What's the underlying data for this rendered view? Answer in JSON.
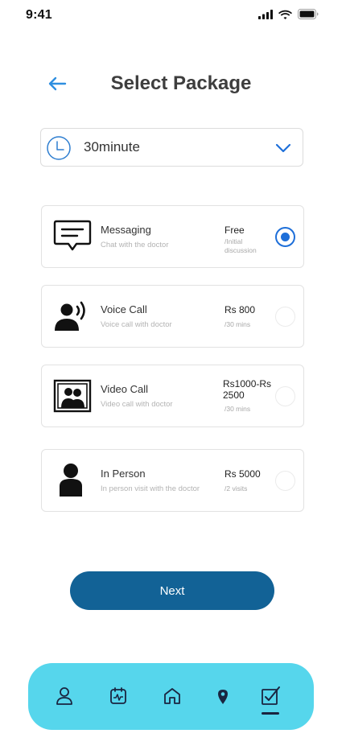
{
  "status": {
    "time": "9:41"
  },
  "header": {
    "title": "Select Package"
  },
  "duration": {
    "value": "30minute"
  },
  "packages": [
    {
      "name": "Messaging",
      "desc": "Chat with the doctor",
      "price": "Free",
      "note": "/Initial discussion",
      "selected": true,
      "icon": "message-icon"
    },
    {
      "name": "Voice Call",
      "desc": "Voice call with doctor",
      "price": "Rs 800",
      "note": "/30 mins",
      "selected": false,
      "icon": "voice-call-icon"
    },
    {
      "name": "Video Call",
      "desc": "Video call with doctor",
      "price": "Rs1000-Rs 2500",
      "note": "/30 mins",
      "selected": false,
      "icon": "video-call-icon"
    },
    {
      "name": "In Person",
      "desc": "In person visit with the doctor",
      "price": "Rs 5000",
      "note": "/2 visits",
      "selected": false,
      "icon": "person-icon"
    }
  ],
  "actions": {
    "next_label": "Next"
  },
  "nav": {
    "items": [
      "profile-icon",
      "calendar-icon",
      "home-icon",
      "location-icon",
      "checklist-icon"
    ],
    "active": "checklist-icon"
  },
  "colors": {
    "accent": "#1e6fd9",
    "button": "#126296",
    "nav_bg": "#56d6ec"
  }
}
